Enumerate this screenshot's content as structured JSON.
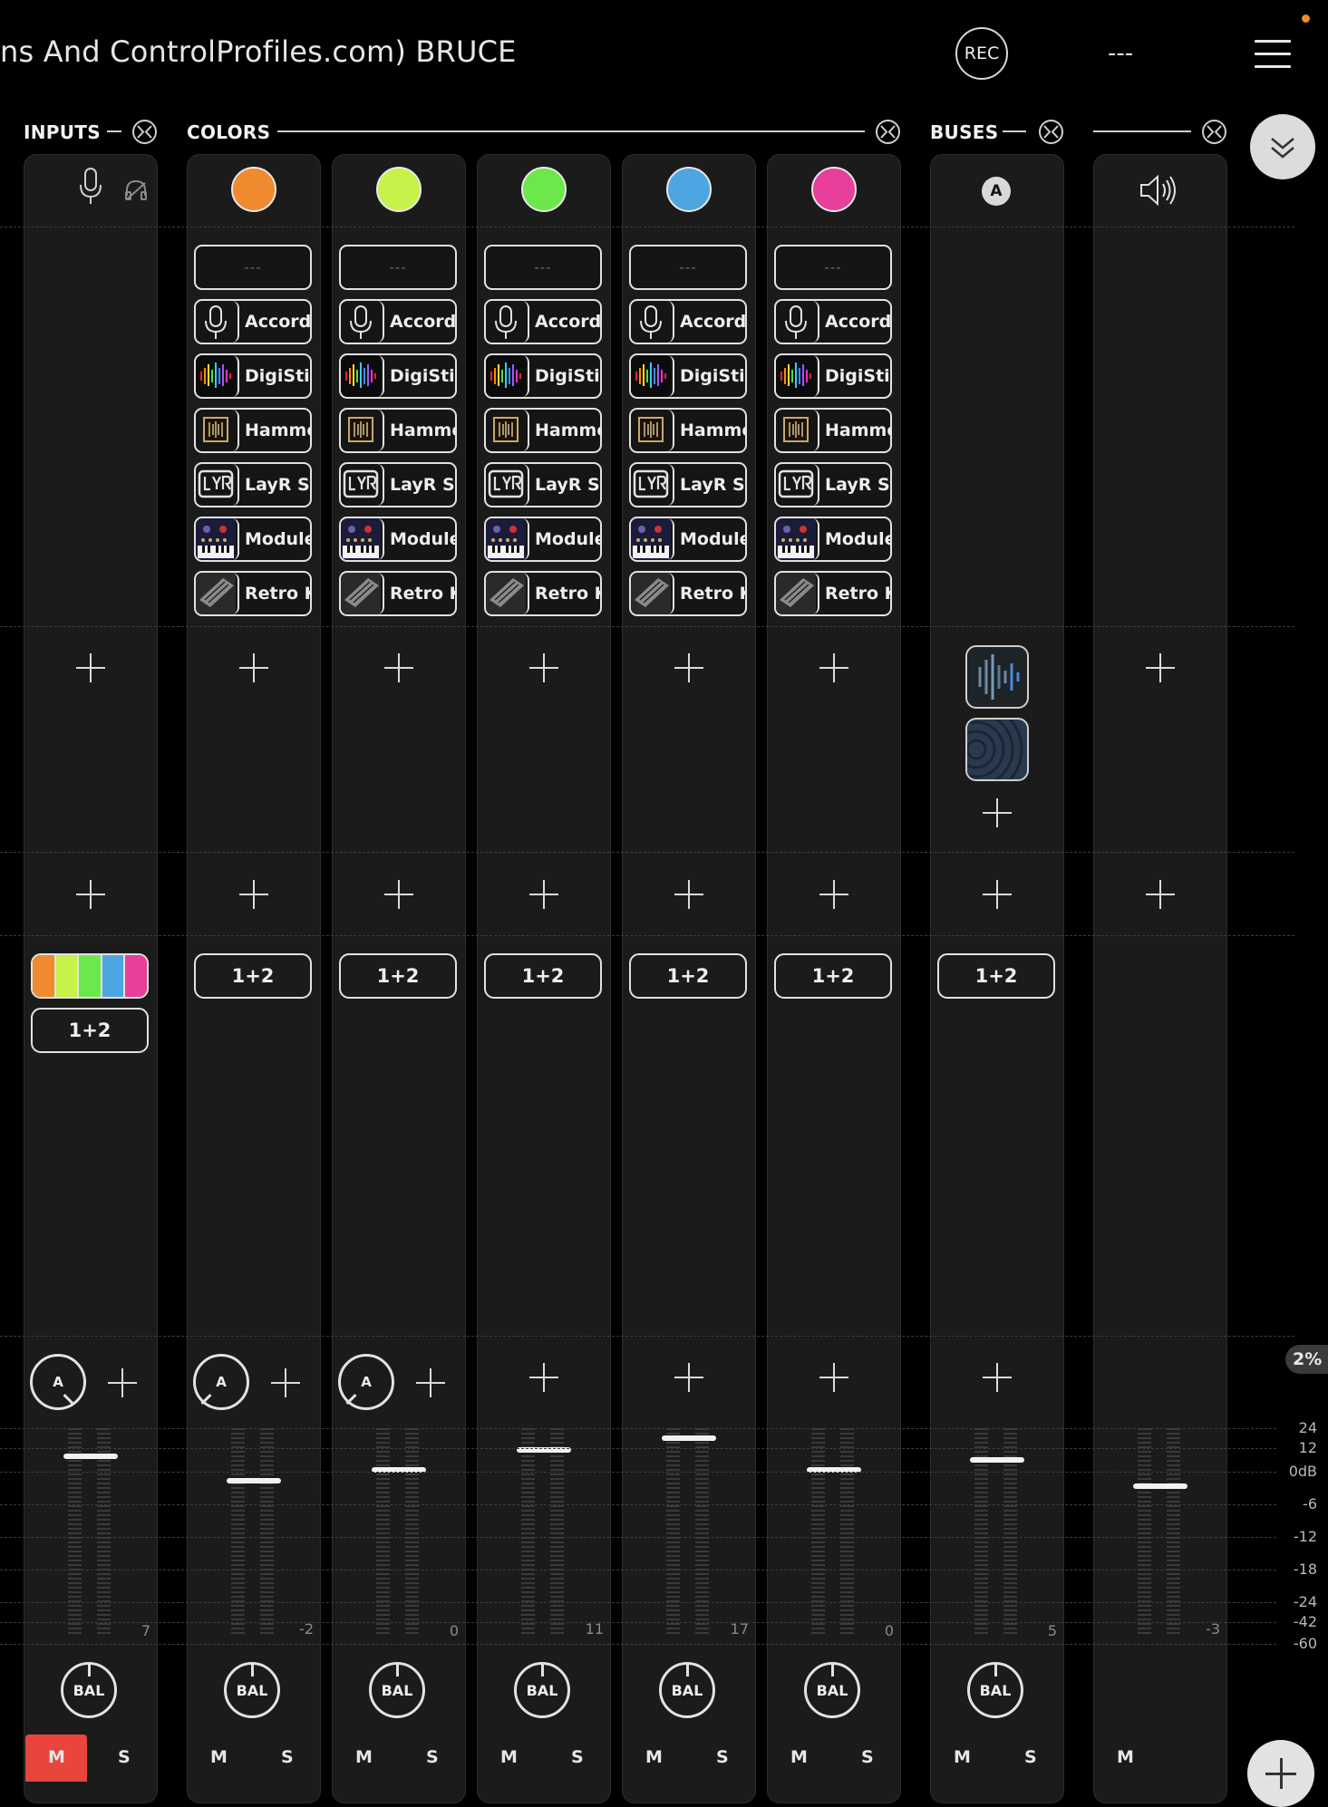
{
  "header": {
    "title": "ns And ControlProfiles.com) BRUCE",
    "rec_label": "REC",
    "scene_label": "---"
  },
  "sections": {
    "inputs": "INPUTS",
    "colors": "COLORS",
    "buses": "BUSES"
  },
  "plugin_rows": [
    {
      "label": "---",
      "icon": "empty"
    },
    {
      "label": "Accordi",
      "icon": "microphone-icon"
    },
    {
      "label": "DigiStix",
      "icon": "digistix-icon"
    },
    {
      "label": "Hammc",
      "icon": "hammond-icon"
    },
    {
      "label": "LayR St",
      "icon": "layr-icon"
    },
    {
      "label": "Module",
      "icon": "module-icon"
    },
    {
      "label": "Retro K",
      "icon": "retrokeys-icon"
    }
  ],
  "channels": {
    "input": {
      "routing": "1+2",
      "knob": "A",
      "gain": "7",
      "bal": "BAL",
      "mute": "M",
      "solo": "S",
      "mute_active": true
    },
    "colors": [
      {
        "color": "#f08a2e",
        "routing": "1+2",
        "knob": "A",
        "gain": "-2",
        "bal": "BAL",
        "mute": "M",
        "solo": "S"
      },
      {
        "color": "#c6f24a",
        "routing": "1+2",
        "knob": "A",
        "gain": "0",
        "bal": "BAL",
        "mute": "M",
        "solo": "S"
      },
      {
        "color": "#6de84a",
        "routing": "1+2",
        "gain": "11",
        "bal": "BAL",
        "mute": "M",
        "solo": "S"
      },
      {
        "color": "#4ea6e0",
        "routing": "1+2",
        "gain": "17",
        "bal": "BAL",
        "mute": "M",
        "solo": "S"
      },
      {
        "color": "#e83e9c",
        "routing": "1+2",
        "gain": "0",
        "bal": "BAL",
        "mute": "M",
        "solo": "S"
      }
    ],
    "bus_a": {
      "label": "A",
      "routing": "1+2",
      "gain": "5",
      "bal": "BAL",
      "mute": "M",
      "solo": "S"
    },
    "master": {
      "gain": "-3",
      "mute": "M"
    }
  },
  "meter_scale": [
    "24",
    "12",
    "0dB",
    "-6",
    "-12",
    "-18",
    "-24",
    "-42",
    "-60"
  ],
  "cpu": "2%",
  "colors": {
    "background": "#000000",
    "strip": "#1b1b1c",
    "mute_active": "#e8463d"
  }
}
